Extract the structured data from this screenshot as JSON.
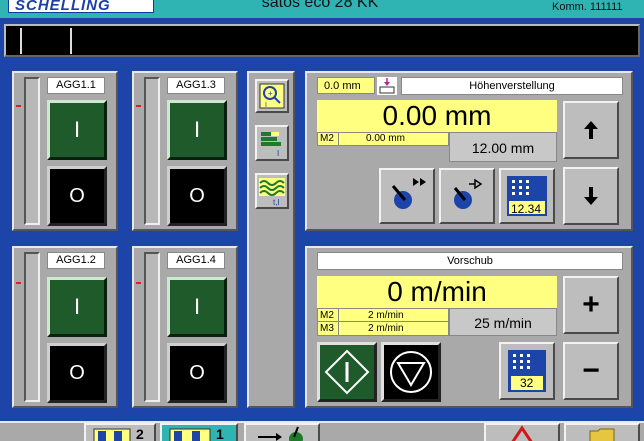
{
  "header": {
    "logo": "SCHELLING",
    "title": "satos eco 28 KK",
    "komm": "Komm. 111111"
  },
  "aggregates": [
    {
      "label": "AGG1.1",
      "on": "I",
      "off": "O"
    },
    {
      "label": "AGG1.3",
      "on": "I",
      "off": "O"
    },
    {
      "label": "AGG1.2",
      "on": "I",
      "off": "O"
    },
    {
      "label": "AGG1.4",
      "on": "I",
      "off": "O"
    }
  ],
  "tools": {
    "zoom_icon": "magnify-i-icon",
    "bars_icon": "bar-chart-i-icon",
    "wave_icon": "wave-t-i-icon",
    "wave_label": "t,I"
  },
  "height": {
    "small_value": "0.0 mm",
    "title": "Höhenverstellung",
    "main_value": "0.00 mm",
    "m2_label": "M2",
    "m2_value": "0.00 mm",
    "target": "12.00 mm",
    "keypad_value": "12.34"
  },
  "feed": {
    "title": "Vorschub",
    "main_value": "0 m/min",
    "m2_label": "M2",
    "m2_value": "2 m/min",
    "m3_label": "M3",
    "m3_value": "2 m/min",
    "target": "25 m/min",
    "keypad_value": "32",
    "plus": "+",
    "minus": "−"
  },
  "footer": {
    "btn1_num": "2",
    "btn2_num": "1"
  },
  "colors": {
    "background": "#1d44a8",
    "header": "#2fb3b3",
    "highlight": "#ffff80",
    "start_green": "#1e5a2a"
  }
}
